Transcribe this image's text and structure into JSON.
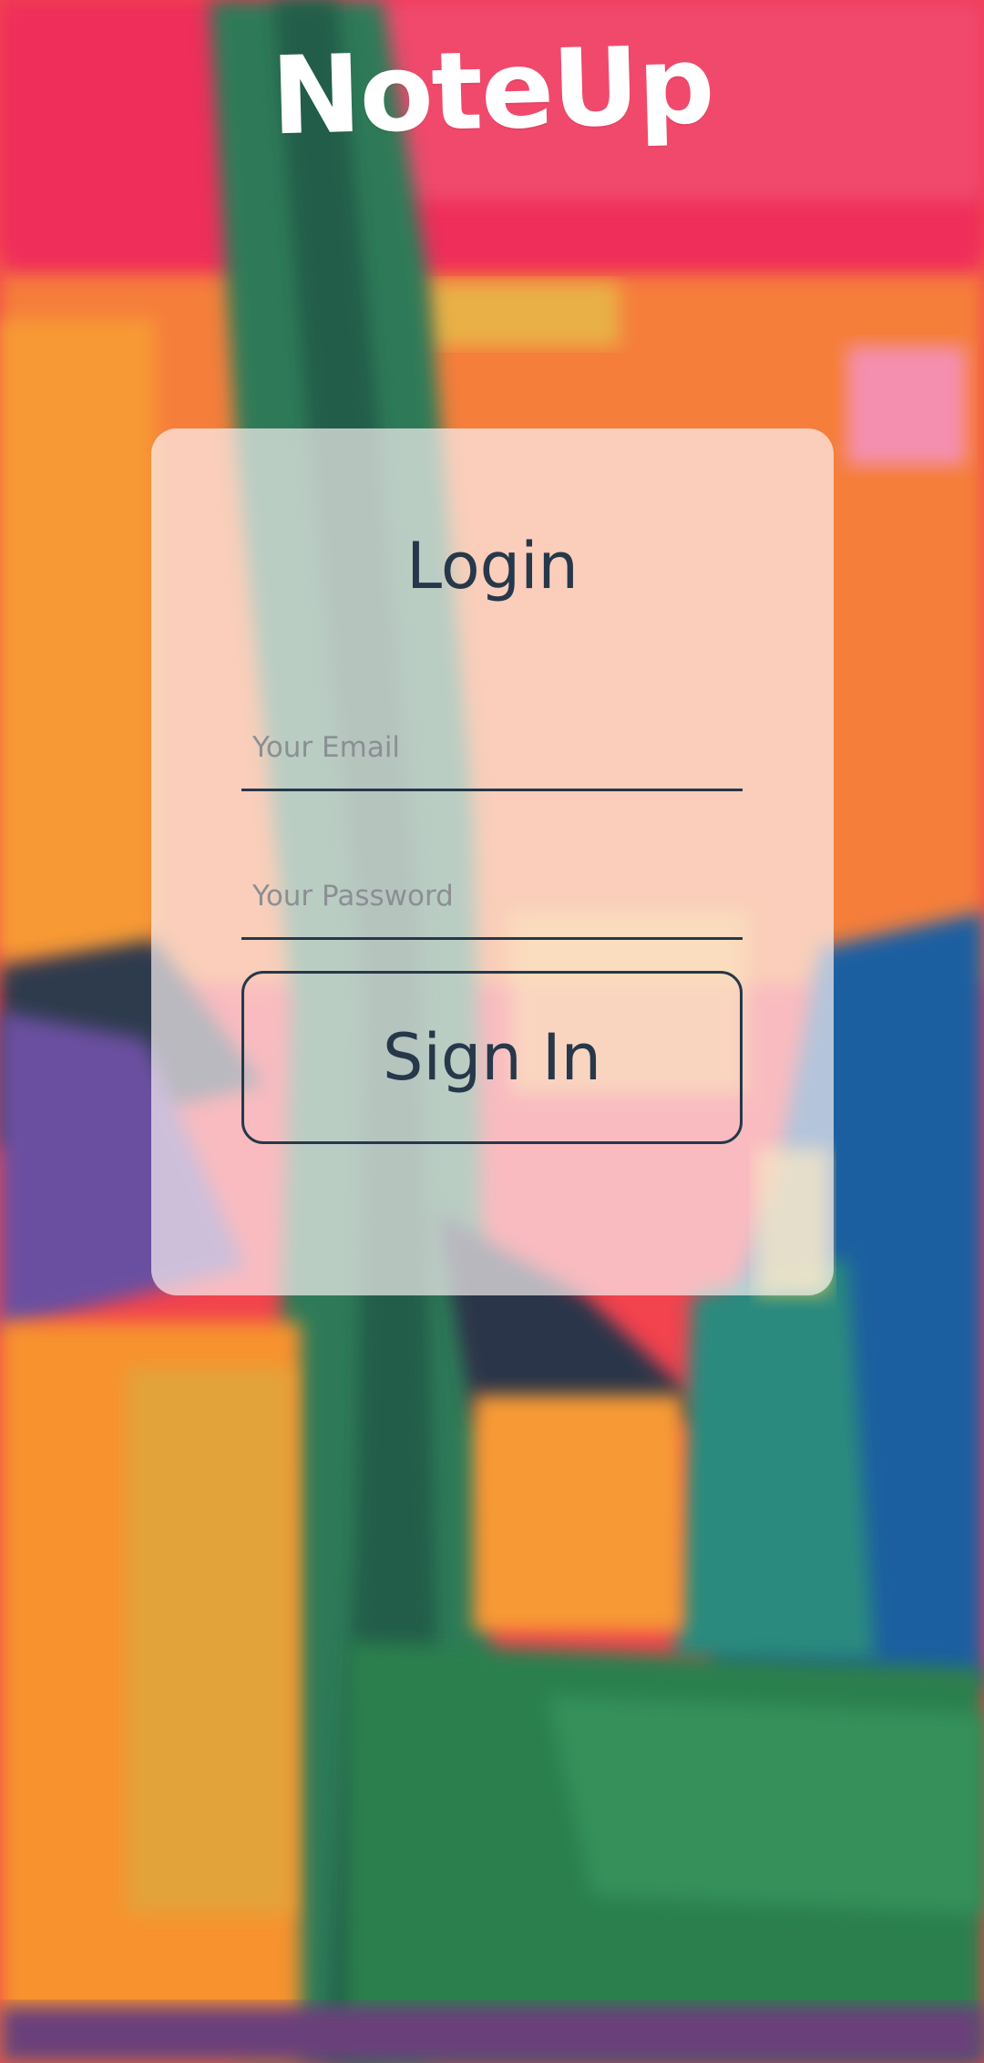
{
  "app": {
    "logo_text": "NoteUp"
  },
  "login": {
    "title": "Login",
    "email_placeholder": "Your Email",
    "email_value": "",
    "password_placeholder": "Your Password",
    "password_value": "",
    "sign_in_label": "Sign In"
  },
  "colors": {
    "text_dark": "#26384a",
    "placeholder": "#8b8f93",
    "card_background": "#fcf4f6",
    "logo": "#ffffff"
  },
  "icons": {
    "background": "abstract-painting-image"
  }
}
